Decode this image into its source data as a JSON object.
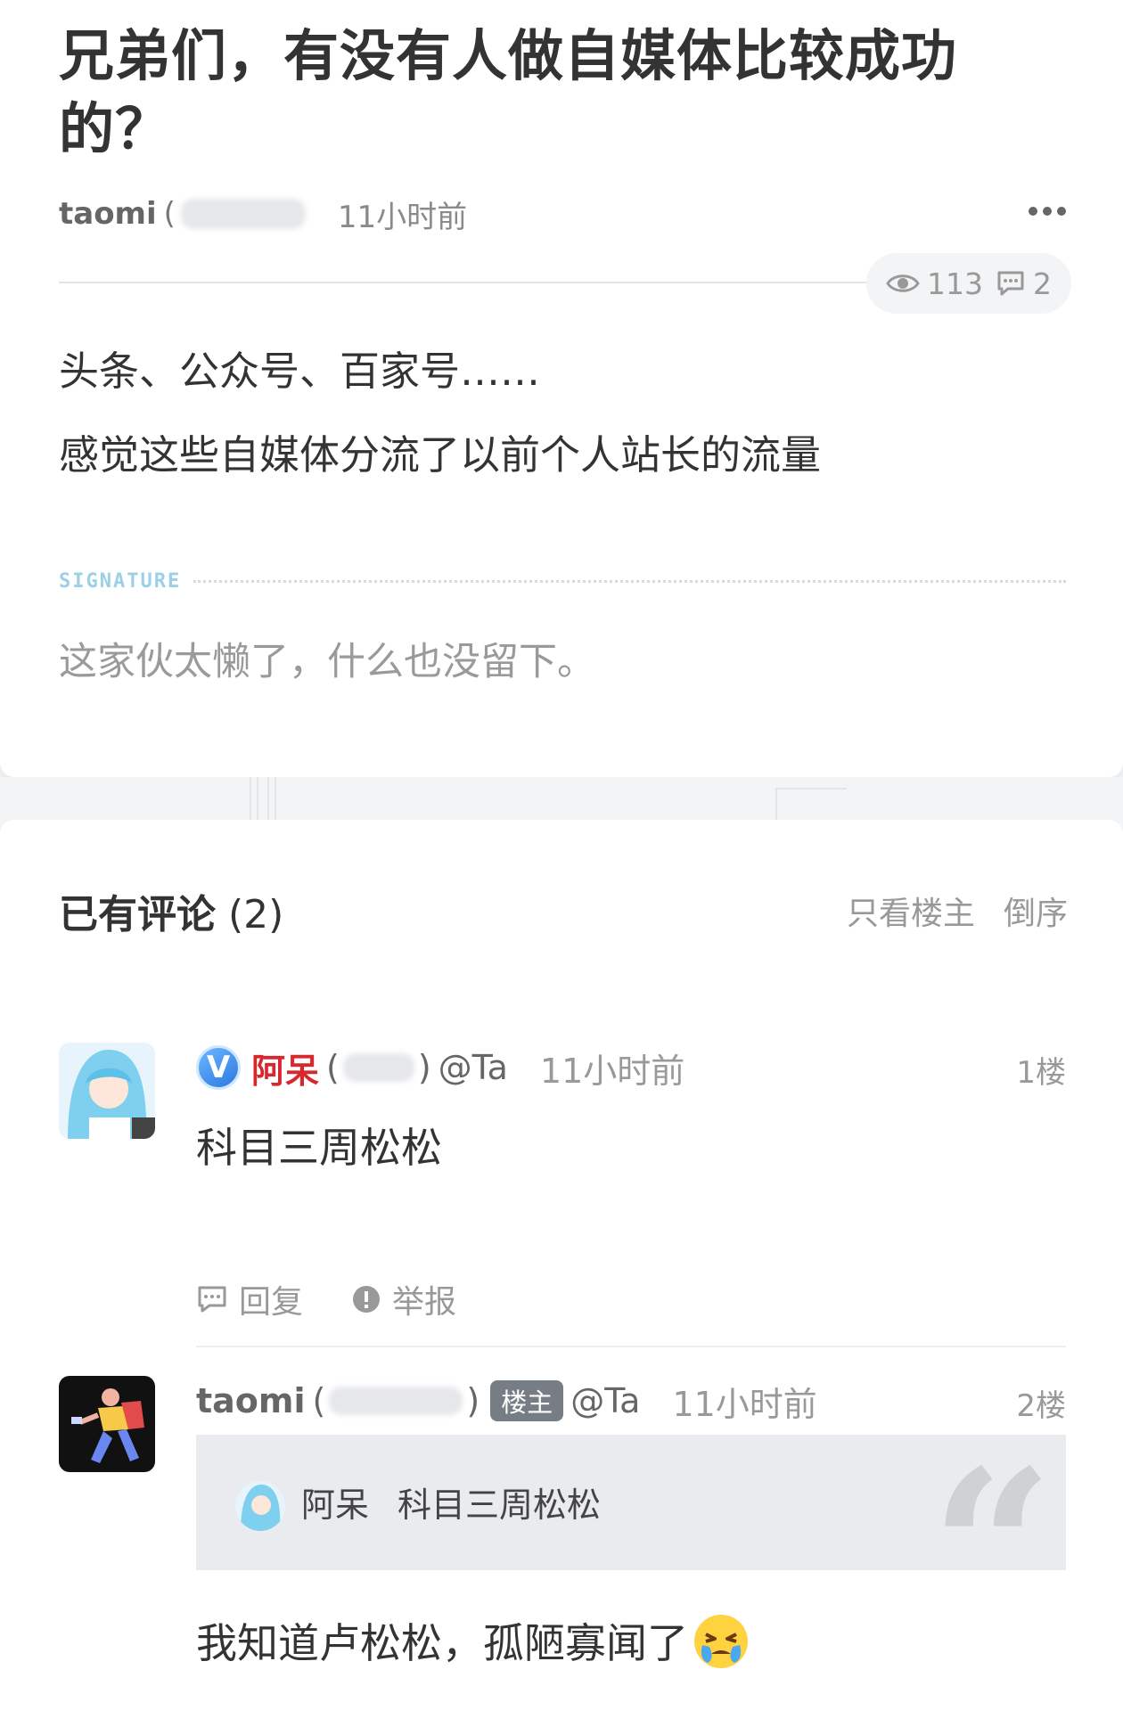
{
  "post": {
    "title": "兄弟们，有没有人做自媒体比较成功的？",
    "author": "taomi",
    "author_suffix": "(",
    "time": "11小时前",
    "views": "113",
    "comment_count": "2",
    "body_lines": [
      "头条、公众号、百家号……",
      "感觉这些自媒体分流了以前个人站长的流量"
    ],
    "signature_label": "SIGNATURE",
    "signature_text": "这家伙太懒了，什么也没留下。"
  },
  "comments_section": {
    "title": "已有评论",
    "count": "(2)",
    "only_op": "只看楼主",
    "reverse": "倒序"
  },
  "comments": [
    {
      "name": "阿呆",
      "paren_open": "(",
      "paren_close": ")",
      "at": "@Ta",
      "time": "11小时前",
      "floor": "1楼",
      "text": "科目三周松松",
      "reply": "回复",
      "report": "举报",
      "verified": "V"
    },
    {
      "name": "taomi",
      "paren_open": "(",
      "paren_close": ")",
      "badge": "楼主",
      "at": "@Ta",
      "time": "11小时前",
      "floor": "2楼",
      "quote_name": "阿呆",
      "quote_text": "科目三周松松",
      "quote_mark": "“",
      "text": "我知道卢松松，孤陋寡闻了"
    }
  ],
  "colors": {
    "red_name": "#d9272e",
    "badge_gray": "#777d85",
    "signature_blue": "#9bd0e6"
  },
  "icons": [
    "more-icon",
    "eye-icon",
    "comment-bubble-icon",
    "reply-icon",
    "report-icon",
    "verified-icon",
    "crying-emoji-icon"
  ]
}
